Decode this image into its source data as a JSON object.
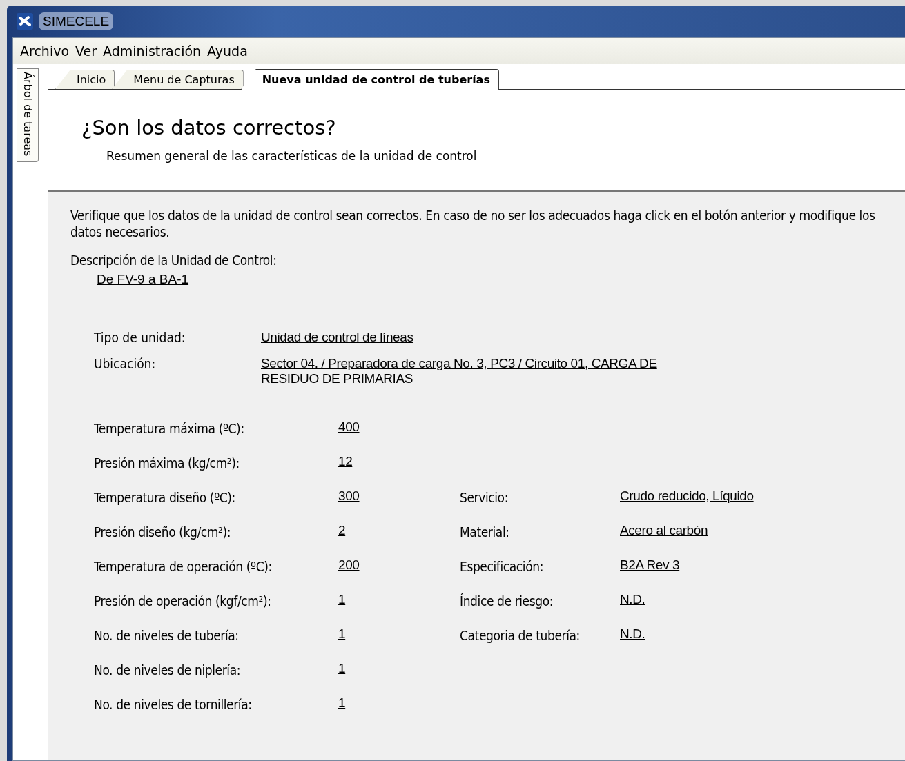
{
  "window": {
    "title": "SIMECELE"
  },
  "menu": [
    "Archivo",
    "Ver",
    "Administración",
    "Ayuda"
  ],
  "side_tab": {
    "label": "Árbol de tareas"
  },
  "tabs": [
    {
      "label": "Inicio",
      "selected": false
    },
    {
      "label": "Menu  de Capturas",
      "selected": false
    },
    {
      "label": "Nueva unidad de control de tuberías",
      "selected": true
    }
  ],
  "header": {
    "title": "¿Son los datos correctos?",
    "subtitle": "Resumen general de las características de la unidad de control"
  },
  "instructions": "Verifique que los datos de la unidad de control sean correctos. En caso de no ser los adecuados haga click en el botón anterior y modifique los datos necesarios.",
  "description": {
    "label": "Descripción de la Unidad de Control:",
    "value": "De FV-9 a BA-1"
  },
  "unit": [
    {
      "label": "Tipo de unidad:",
      "value": "Unidad de control de líneas "
    },
    {
      "label": "Ubicación:",
      "value": "Sector 04.  / Preparadora de carga No. 3, PC3 / Circuito 01, CARGA DE RESIDUO DE PRIMARIAS"
    }
  ],
  "specs_left": [
    {
      "label": "Temperatura máxima (ºC):",
      "value": "400"
    },
    {
      "label": "Presión máxima (kg/cm²):",
      "value": "12"
    },
    {
      "label": "Temperatura diseño (ºC):",
      "value": "300"
    },
    {
      "label": "Presión diseño (kg/cm²):",
      "value": "2"
    },
    {
      "label": "Temperatura de operación (ºC):",
      "value": "200"
    },
    {
      "label": "Presión de operación (kgf/cm²):",
      "value": "1"
    },
    {
      "label": "No. de niveles de tubería:",
      "value": "1"
    },
    {
      "label": "No. de niveles de niplería:",
      "value": "1"
    },
    {
      "label": "No. de niveles de tornillería:",
      "value": "1"
    }
  ],
  "specs_right": [
    {
      "label": "Servicio:",
      "value": "Crudo reducido, Líquido"
    },
    {
      "label": "Material:",
      "value": "Acero al carbón"
    },
    {
      "label": "Especificación:",
      "value": "B2A Rev 3"
    },
    {
      "label": "Índice de riesgo:",
      "value": "N.D."
    },
    {
      "label": "Categoria de tubería:",
      "value": "N.D."
    }
  ]
}
